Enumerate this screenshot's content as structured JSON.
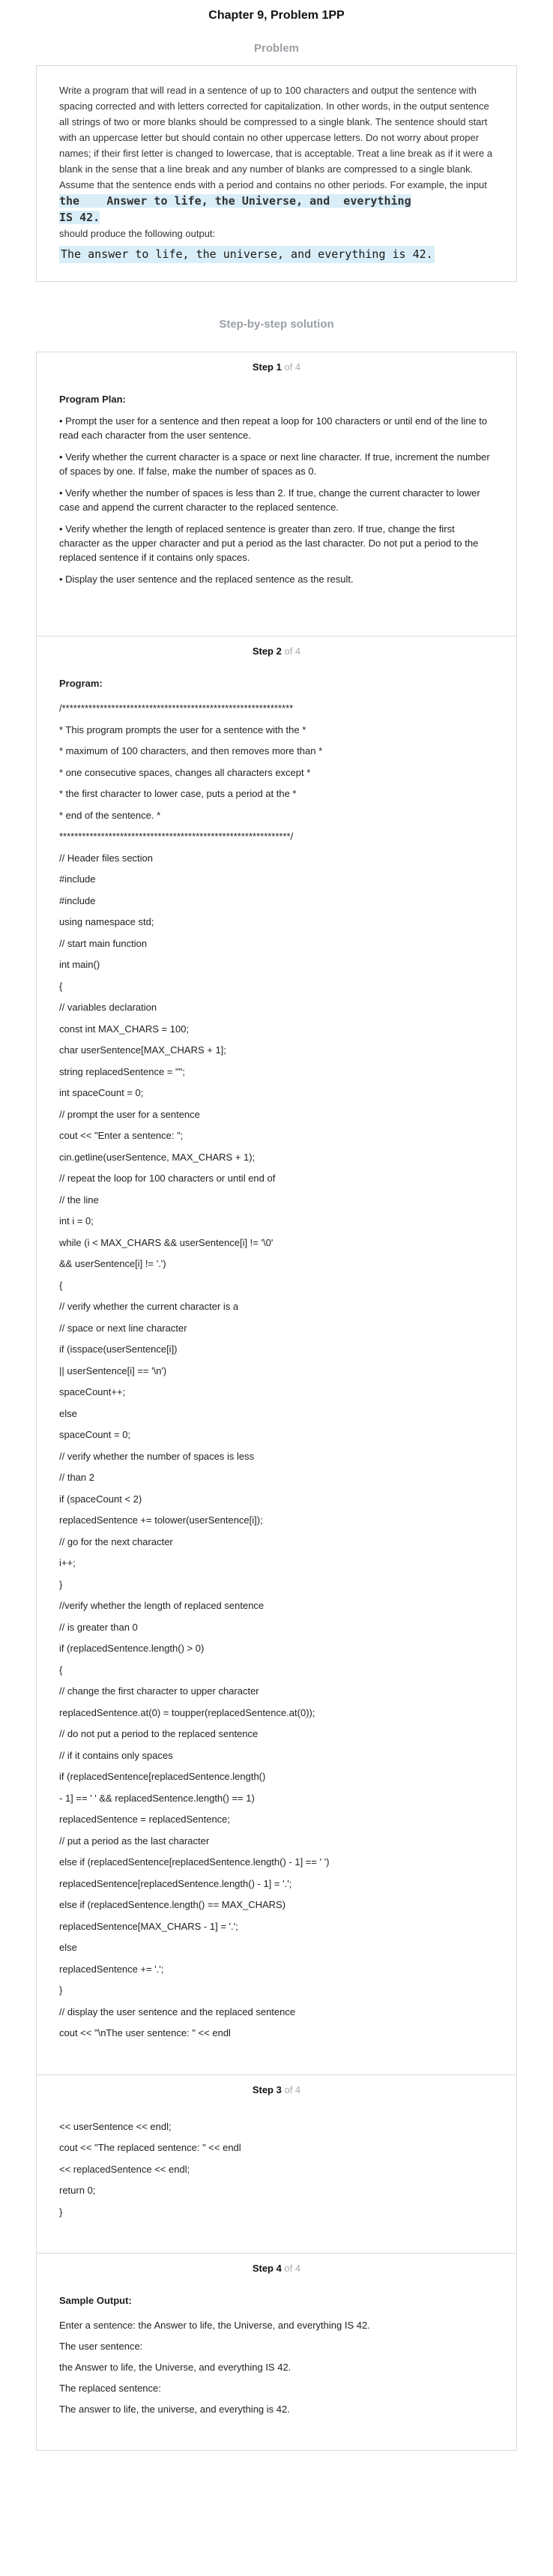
{
  "title": "Chapter 9, Problem 1PP",
  "problem_label": "Problem",
  "problem": {
    "text": "Write a program that will read in a sentence of up to 100 characters and output the sentence with spacing corrected and with letters corrected for capitalization. In other words, in the output sentence all strings of two or more blanks should be compressed to a single blank. The sentence should start with an uppercase letter but should contain no other uppercase letters. Do not worry about proper names; if their first letter is changed to lowercase, that is acceptable. Treat a line break as if it were a blank in the sense that a line break and any number of blanks are compressed to a single blank. Assume that the sentence ends with a period and contains no other periods. For example, the input",
    "input_example": "the    Answer to life, the Universe, and  everything\nIS 42.",
    "mid_text": "should produce the following output:",
    "output_example": "The answer to life, the universe, and everything is 42."
  },
  "solution_label": "Step-by-step solution",
  "step_of": "of 4",
  "steps": [
    {
      "label": "Step 1",
      "heading": "Program Plan:",
      "bullets": [
        "• Prompt the user for a sentence and then repeat a loop for 100 characters or until end of the line to read each character from the user sentence.",
        "• Verify whether the current character is a space or next line character. If true, increment the number of spaces by one. If false, make the number of spaces as 0.",
        "• Verify whether the number of spaces is less than 2. If true, change the current character to lower case and append the current character to the replaced sentence.",
        "• Verify whether the length of replaced sentence is greater than zero. If true, change the first character as the upper character and put a period as the last character. Do not put a period to the replaced sentence if it contains only spaces.",
        "• Display the user sentence and the replaced sentence as the result."
      ]
    },
    {
      "label": "Step 2",
      "heading": "Program:",
      "lines": [
        "/*************************************************************",
        "* This program prompts the user for a sentence with the *",
        "* maximum of 100 characters, and then removes more than *",
        "* one consecutive spaces, changes all characters except *",
        "* the first character to lower case, puts a period at the *",
        "* end of the sentence. *",
        "*************************************************************/",
        "// Header files section",
        "#include",
        "#include",
        "using namespace std;",
        "// start main function",
        "int main()",
        "{",
        "// variables declaration",
        "const int MAX_CHARS = 100;",
        "char userSentence[MAX_CHARS + 1];",
        "string replacedSentence = \"\";",
        "int spaceCount = 0;",
        "// prompt the user for a sentence",
        "cout << \"Enter a sentence: \";",
        "cin.getline(userSentence, MAX_CHARS + 1);",
        "// repeat the loop for 100 characters or until end of",
        "// the line",
        "int i = 0;",
        "while (i < MAX_CHARS && userSentence[i] != '\\0'",
        "&& userSentence[i] != '.')",
        "{",
        "// verify whether the current character is a",
        "// space or next line character",
        "if (isspace(userSentence[i])",
        "|| userSentence[i] == '\\n')",
        "spaceCount++;",
        "else",
        "spaceCount = 0;",
        "// verify whether the number of spaces is less",
        "// than 2",
        "if (spaceCount < 2)",
        "replacedSentence += tolower(userSentence[i]);",
        "// go for the next character",
        "i++;",
        "}",
        "//verify whether the length of replaced sentence",
        "// is greater than 0",
        "if (replacedSentence.length() > 0)",
        "{",
        "// change the first character to upper character",
        "replacedSentence.at(0) = toupper(replacedSentence.at(0));",
        "// do not put a period to the replaced sentence",
        "// if it contains only spaces",
        "if (replacedSentence[replacedSentence.length()",
        "- 1] == ' ' && replacedSentence.length() == 1)",
        "replacedSentence = replacedSentence;",
        "// put a period as the last character",
        "else if (replacedSentence[replacedSentence.length() - 1] == ' ')",
        "replacedSentence[replacedSentence.length() - 1] = '.';",
        "else if (replacedSentence.length() == MAX_CHARS)",
        "replacedSentence[MAX_CHARS - 1] = '.';",
        "else",
        "replacedSentence += '.';",
        "}",
        "// display the user sentence and the replaced sentence",
        "cout << \"\\nThe user sentence: \" << endl"
      ]
    },
    {
      "label": "Step 3",
      "lines": [
        "<< userSentence << endl;",
        "cout << \"The replaced sentence: \" << endl",
        "<< replacedSentence << endl;",
        "return 0;",
        "}"
      ]
    },
    {
      "label": "Step 4",
      "heading": "Sample Output:",
      "lines": [
        "Enter a sentence: the Answer to life, the Universe, and everything IS 42.",
        "The user sentence:",
        "the Answer to life, the Universe, and everything IS 42.",
        "The replaced sentence:",
        "The answer to life, the universe, and everything is 42."
      ]
    }
  ]
}
